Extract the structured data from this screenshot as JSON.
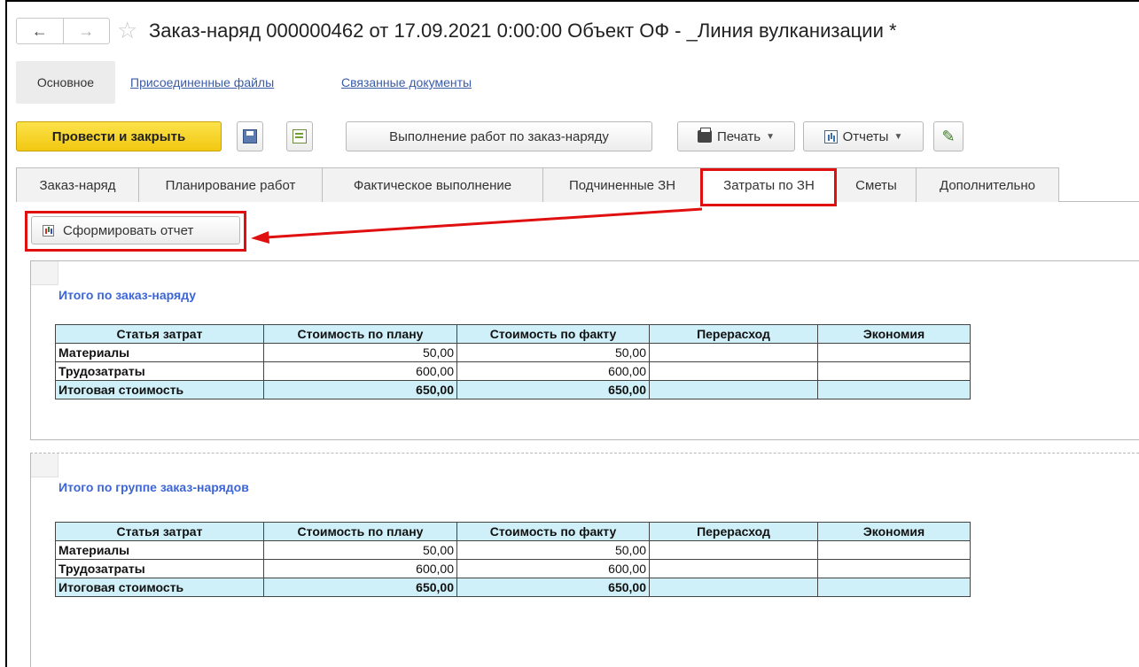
{
  "window": {
    "title": "Заказ-наряд 000000462 от 17.09.2021 0:00:00 Объект ОФ - _Линия вулканизации *",
    "back_glyph": "←",
    "forward_glyph": "→",
    "favorite_glyph": "☆"
  },
  "sections": {
    "main": "Основное",
    "attached_files": "Присоединенные файлы",
    "related_documents": "Связанные документы"
  },
  "toolbar": {
    "post_and_close": "Провести и закрыть",
    "execute_works": "Выполнение работ по заказ-наряду",
    "print": "Печать",
    "reports": "Отчеты"
  },
  "tabs": [
    {
      "label": "Заказ-наряд"
    },
    {
      "label": "Планирование работ"
    },
    {
      "label": "Фактическое выполнение"
    },
    {
      "label": "Подчиненные ЗН"
    },
    {
      "label": "Затраты по ЗН",
      "active": true
    },
    {
      "label": "Сметы"
    },
    {
      "label": "Дополнительно"
    }
  ],
  "report_button": "Сформировать отчет",
  "reports": [
    {
      "title": "Итого по заказ-наряду",
      "columns": [
        "Статья затрат",
        "Стоимость по плану",
        "Стоимость по факту",
        "Перерасход",
        "Экономия"
      ],
      "rows": [
        [
          "Материалы",
          "50,00",
          "50,00",
          "",
          ""
        ],
        [
          "Трудозатраты",
          "600,00",
          "600,00",
          "",
          ""
        ],
        [
          "Итоговая стоимость",
          "650,00",
          "650,00",
          "",
          ""
        ]
      ]
    },
    {
      "title": "Итого по группе заказ-нарядов",
      "columns": [
        "Статья затрат",
        "Стоимость по плану",
        "Стоимость по факту",
        "Перерасход",
        "Экономия"
      ],
      "rows": [
        [
          "Материалы",
          "50,00",
          "50,00",
          "",
          ""
        ],
        [
          "Трудозатраты",
          "600,00",
          "600,00",
          "",
          ""
        ],
        [
          "Итоговая стоимость",
          "650,00",
          "650,00",
          "",
          ""
        ]
      ]
    }
  ],
  "colors": {
    "highlight": "#e01010",
    "primary_button": "#f2c811",
    "table_header": "#cff0f8",
    "report_title": "#3c65d8",
    "link": "#3a5ba8"
  }
}
